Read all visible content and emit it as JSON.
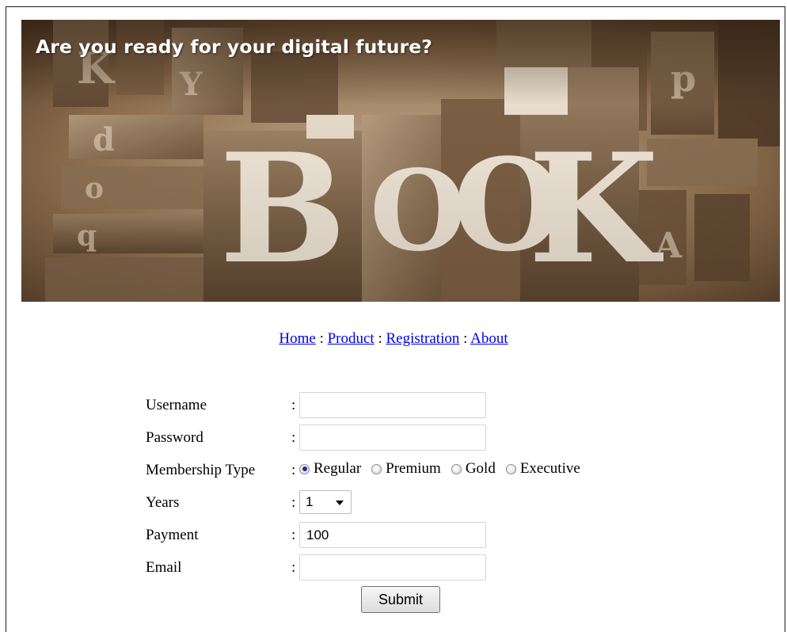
{
  "banner": {
    "title": "Are you ready for your digital future?",
    "letters": [
      "B",
      "O",
      "O",
      "K"
    ]
  },
  "nav": {
    "links": [
      "Home",
      "Product",
      "Registration",
      "About"
    ],
    "separator": ":"
  },
  "form": {
    "colon": ":",
    "username": {
      "label": "Username",
      "value": ""
    },
    "password": {
      "label": "Password",
      "value": ""
    },
    "membership": {
      "label": "Membership Type",
      "options": [
        "Regular",
        "Premium",
        "Gold",
        "Executive"
      ],
      "selected": "Regular"
    },
    "years": {
      "label": "Years",
      "value": "1"
    },
    "payment": {
      "label": "Payment",
      "value": "100"
    },
    "email": {
      "label": "Email",
      "value": ""
    },
    "submit_label": "Submit"
  }
}
